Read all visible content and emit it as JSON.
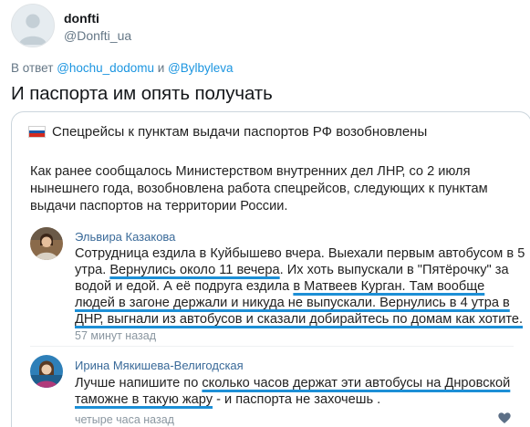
{
  "author": {
    "display_name": "donfti",
    "handle": "@Donfti_ua"
  },
  "reply": {
    "prefix": "В ответ",
    "mention_1": "@hochu_dodomu",
    "conjunction": "и",
    "mention_2": "@Bylbyleva"
  },
  "tweet": {
    "text": "И паспорта им опять получать"
  },
  "embedded_news": {
    "flag_icon": "russian-flag-icon",
    "flag_colors": [
      "#ffffff",
      "#1c57a5",
      "#d52b1e"
    ],
    "title": "Спецрейсы к пунктам выдачи паспортов РФ возобновлены",
    "body": "Как ранее сообщалось Министерством внутренних дел ЛНР, со 2 июля нынешнего года, возобновлена работа спецрейсов, следующих к пунктам выдачи паспортов на территории России."
  },
  "comments": [
    {
      "name": "Эльвира Казакова",
      "time": "57 минут назад",
      "segments": [
        "Сотрудница ездила в Куйбышево вчера. Выехали первым автобусом в 5 утра. ",
        "Вернулись около 11 вечера",
        ". Их хоть выпускали в \"Пятёрочку\" за водой и едой. А её подруга ездила ",
        "в Матвеев Курган. Там вообще людей в загоне держали и никуда не выпускали. Вернулись в 4 утра в ДНР, выгнали из автобусов и сказали добирайтесь по домам как хотите."
      ]
    },
    {
      "name": "Ирина Мякишева-Велигодская",
      "time": "четыре часа назад",
      "segments": [
        "Лучше напишите по ",
        "сколько часов держат эти автобусы на Днровской таможне в такую жару",
        " - и паспорта не захочешь ."
      ]
    }
  ],
  "accent_color": "#1d8fd6",
  "link_color": "#1b95e0"
}
